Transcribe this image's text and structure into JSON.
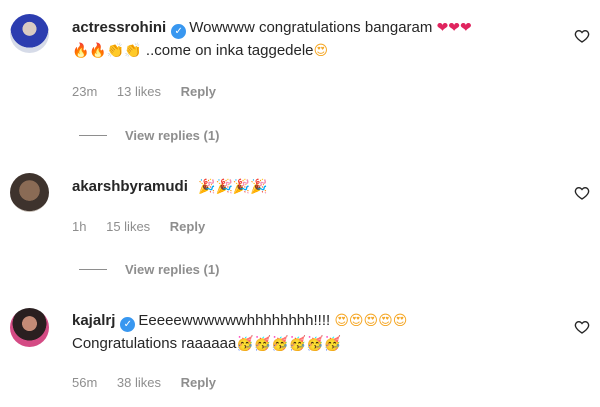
{
  "comments": [
    {
      "username": "actressrohini",
      "verified": true,
      "text_line1": "Wowwww congratulations bangaram",
      "emoji_line1": "❤❤❤",
      "emoji_line2_prefix": "🔥🔥👏👏",
      "text_line2": " ..come on inka taggedele",
      "emoji_line2_suffix": "😍",
      "time": "23m",
      "likes": "13 likes",
      "reply": "Reply",
      "view_replies": "View replies (1)"
    },
    {
      "username": "akarshbyramudi",
      "verified": false,
      "text_line1": "",
      "emoji_line1": "🎉🎉🎉🎉",
      "time": "1h",
      "likes": "15 likes",
      "reply": "Reply",
      "view_replies": "View replies (1)"
    },
    {
      "username": "kajalrj",
      "verified": true,
      "text_line1": "Eeeeewwwwwwhhhhhhhh!!!!",
      "emoji_line1": "😍😍😍😍😍",
      "text_line2": "Congratulations raaaaaa",
      "emoji_line2_suffix": "🥳🥳🥳🥳🥳🥳",
      "time": "56m",
      "likes": "38 likes",
      "reply": "Reply"
    }
  ],
  "icons": {
    "like": "heart-outline-icon",
    "verified": "verified-badge-icon"
  },
  "colors": {
    "muted": "#8e8e8e",
    "verified": "#3897f0",
    "text": "#262626"
  }
}
